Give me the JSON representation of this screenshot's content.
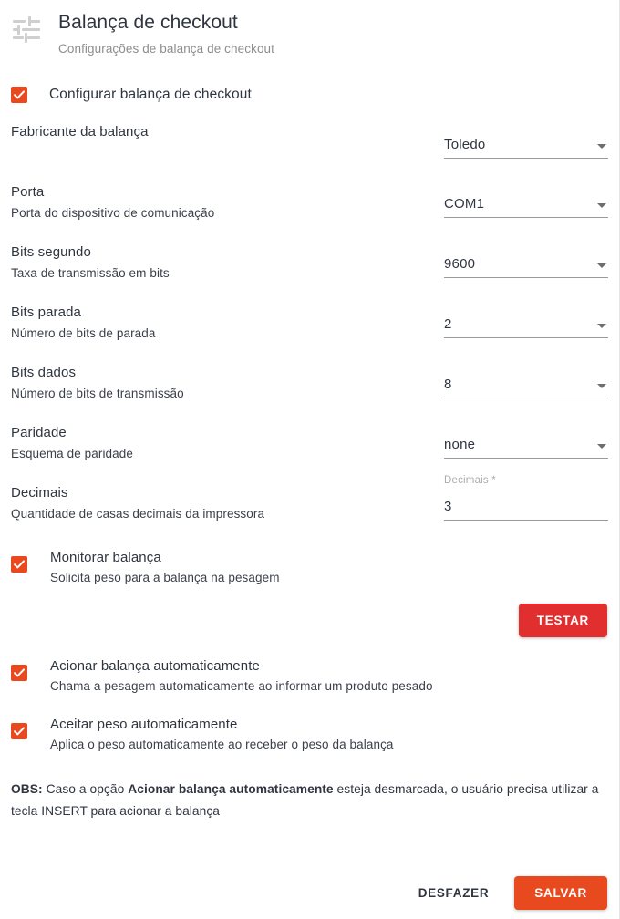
{
  "header": {
    "icon": "tune-sliders-icon",
    "title": "Balança de checkout",
    "subtitle": "Configurações de balança de checkout"
  },
  "enable_checkbox": {
    "label": "Configurar balança de checkout",
    "checked": true
  },
  "fields": [
    {
      "label": "Fabricante da balança",
      "description": "",
      "value": "Toledo",
      "type": "select",
      "float_label": ""
    },
    {
      "label": "Porta",
      "description": "Porta do dispositivo de comunicação",
      "value": "COM1",
      "type": "select",
      "float_label": ""
    },
    {
      "label": "Bits segundo",
      "description": "Taxa de transmissão em bits",
      "value": "9600",
      "type": "select",
      "float_label": ""
    },
    {
      "label": "Bits parada",
      "description": "Número de bits de parada",
      "value": "2",
      "type": "select",
      "float_label": ""
    },
    {
      "label": "Bits dados",
      "description": "Número de bits de transmissão",
      "value": "8",
      "type": "select",
      "float_label": ""
    },
    {
      "label": "Paridade",
      "description": "Esquema de paridade",
      "value": "none",
      "type": "select",
      "float_label": ""
    },
    {
      "label": "Decimais",
      "description": "Quantidade de casas decimais da impressora",
      "value": "3",
      "type": "text",
      "float_label": "Decimais *"
    }
  ],
  "options": [
    {
      "title": "Monitorar balança",
      "description": "Solicita peso para a balança na pesagem",
      "checked": true
    },
    {
      "title": "Acionar balança automaticamente",
      "description": "Chama a pesagem automaticamente ao informar um produto pesado",
      "checked": true
    },
    {
      "title": "Aceitar peso automaticamente",
      "description": "Aplica o peso automaticamente ao receber o peso da balança",
      "checked": true
    }
  ],
  "test_button": {
    "label": "TESTAR"
  },
  "obs": {
    "prefix": "OBS:",
    "text_1": " Caso a opção ",
    "bold": "Acionar balança automaticamente",
    "text_2": " esteja desmarcada, o usuário precisa utilizar a tecla INSERT para acionar a balança"
  },
  "footer": {
    "undo_label": "DESFAZER",
    "save_label": "SALVAR"
  },
  "colors": {
    "accent_orange": "#e8491e",
    "test_red": "#e12f2f",
    "text_dark": "#2f3540",
    "text_muted": "#8d8d8d",
    "field_underline": "#9a9a9a"
  }
}
